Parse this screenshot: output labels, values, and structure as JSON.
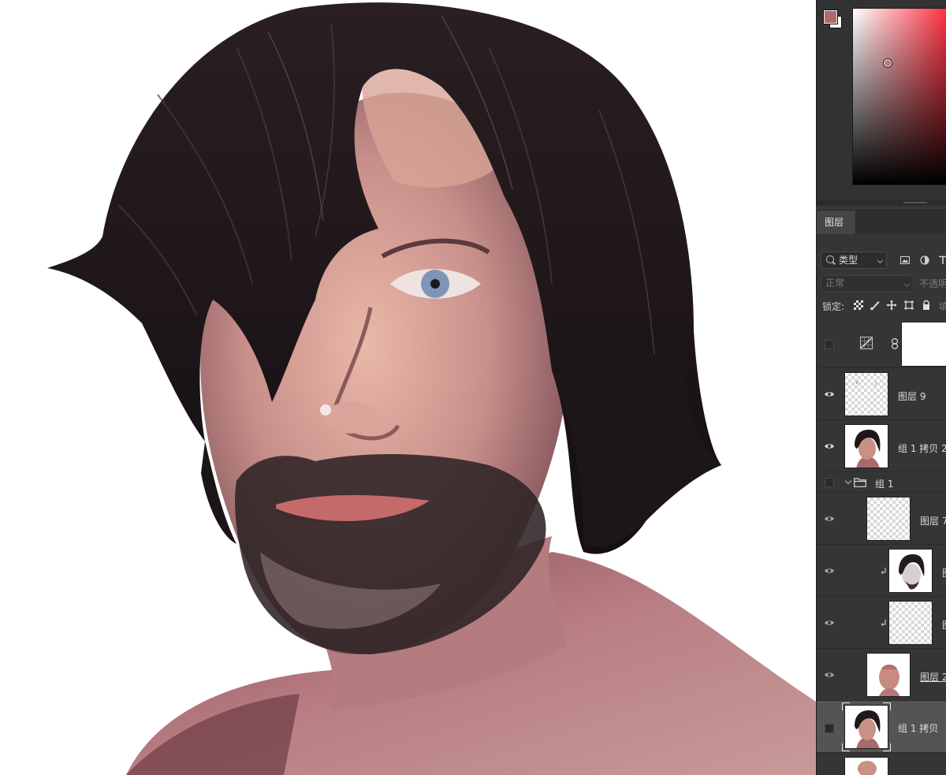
{
  "canvas": {
    "artwork": "digital-painting-portrait"
  },
  "color_panel": {
    "foreground_color": "#b06a6e",
    "background_color": "#ffffff",
    "hue_color": "#ff2b3a"
  },
  "layers_panel": {
    "tab_label": "图层",
    "filter_label": "类型",
    "blend_mode": "正常",
    "opacity_label": "不透明",
    "lock_label": "锁定:",
    "fill_label": "填",
    "layers": [
      {
        "name": "",
        "visible": false,
        "type": "adjustment",
        "icon": "curves-icon"
      },
      {
        "name": "图层 9",
        "visible": true,
        "type": "pixel"
      },
      {
        "name": "组 1 拷贝 2",
        "visible": true,
        "type": "pixel"
      },
      {
        "name": "组 1",
        "visible": false,
        "type": "group"
      },
      {
        "name": "图层 7",
        "visible": true,
        "type": "pixel"
      },
      {
        "name": "图",
        "visible": true,
        "type": "pixel",
        "clipped": true
      },
      {
        "name": "图",
        "visible": true,
        "type": "pixel",
        "clipped": true
      },
      {
        "name": "图层 2",
        "visible": true,
        "type": "pixel"
      },
      {
        "name": "组 1 拷贝",
        "visible": false,
        "type": "pixel",
        "selected": true
      }
    ]
  }
}
